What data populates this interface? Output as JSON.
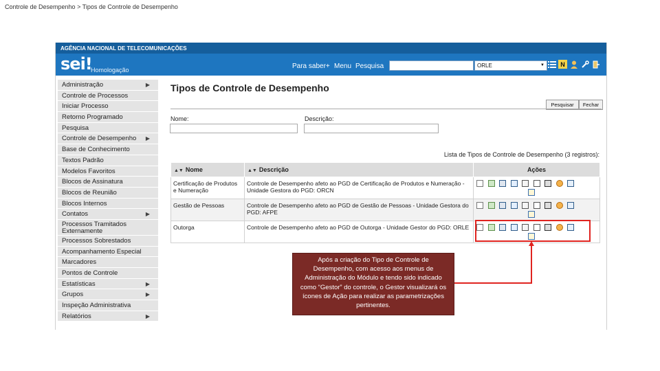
{
  "breadcrumb": "Controle de Desempenho > Tipos de Controle de Desempenho",
  "header": {
    "agency": "AGÊNCIA NACIONAL DE TELECOMUNICAÇÕES",
    "logo": "sei!",
    "environment": "Homologação",
    "nav": {
      "about": "Para saber+",
      "menu": "Menu",
      "search": "Pesquisa"
    },
    "search_value": "",
    "unit_selected": "ORLE",
    "icons": [
      "list-icon",
      "notification-icon",
      "user-icon",
      "tools-icon",
      "exit-icon"
    ]
  },
  "sidebar": {
    "items": [
      {
        "label": "Administração",
        "submenu": true
      },
      {
        "label": "Controle de Processos",
        "submenu": false
      },
      {
        "label": "Iniciar Processo",
        "submenu": false
      },
      {
        "label": "Retorno Programado",
        "submenu": false
      },
      {
        "label": "Pesquisa",
        "submenu": false
      },
      {
        "label": "Controle de Desempenho",
        "submenu": true
      },
      {
        "label": "Base de Conhecimento",
        "submenu": false
      },
      {
        "label": "Textos Padrão",
        "submenu": false
      },
      {
        "label": "Modelos Favoritos",
        "submenu": false
      },
      {
        "label": "Blocos de Assinatura",
        "submenu": false
      },
      {
        "label": "Blocos de Reunião",
        "submenu": false
      },
      {
        "label": "Blocos Internos",
        "submenu": false
      },
      {
        "label": "Contatos",
        "submenu": true
      },
      {
        "label": "Processos Tramitados Externamente",
        "submenu": false
      },
      {
        "label": "Processos Sobrestados",
        "submenu": false
      },
      {
        "label": "Acompanhamento Especial",
        "submenu": false
      },
      {
        "label": "Marcadores",
        "submenu": false
      },
      {
        "label": "Pontos de Controle",
        "submenu": false
      },
      {
        "label": "Estatísticas",
        "submenu": true
      },
      {
        "label": "Grupos",
        "submenu": true
      },
      {
        "label": "Inspeção Administrativa",
        "submenu": false
      },
      {
        "label": "Relatórios",
        "submenu": true
      }
    ]
  },
  "main": {
    "title": "Tipos de Controle de Desempenho",
    "buttons": {
      "search": "Pesquisar",
      "close": "Fechar"
    },
    "filters": {
      "name_label": "Nome:",
      "name_value": "",
      "description_label": "Descrição:",
      "description_value": ""
    },
    "list_caption": "Lista de Tipos de Controle de Desempenho (3 registros):",
    "table": {
      "columns": [
        "Nome",
        "Descrição",
        "Ações"
      ],
      "rows": [
        {
          "name": "Certificação de Produtos e Numeração",
          "description": "Controle de Desempenho afeto ao PGD de Certificação de Produtos e Numeração - Unidade Gestora do PGD: ORCN"
        },
        {
          "name": "Gestão de Pessoas",
          "description": "Controle de Desempenho afeto ao PGD de Gestão de Pessoas - Unidade Gestora do PGD: AFPE"
        },
        {
          "name": "Outorga",
          "description": "Controle de Desempenho afeto ao PGD de Outorga - Unidade Gestor do PGD: ORLE"
        }
      ],
      "action_icons": [
        "list-icon",
        "search-icon",
        "download-icon",
        "edit-icon",
        "copy-icon",
        "document-icon",
        "print-icon",
        "settings-icon",
        "chart-icon",
        "edit-note-icon"
      ]
    }
  },
  "callout": {
    "text": "Após a criação do Tipo de Controle de Desempenho, com acesso aos menus de Administração do Módulo e tendo sido indicado como “Gestor” do controle, o Gestor visualizará os ícones de Ação para realizar as parametrizações pertinentes."
  },
  "colors": {
    "header_dark": "#155e9c",
    "header": "#1e76c0",
    "highlight": "#e0231f",
    "callout_bg": "#7b2a26"
  }
}
